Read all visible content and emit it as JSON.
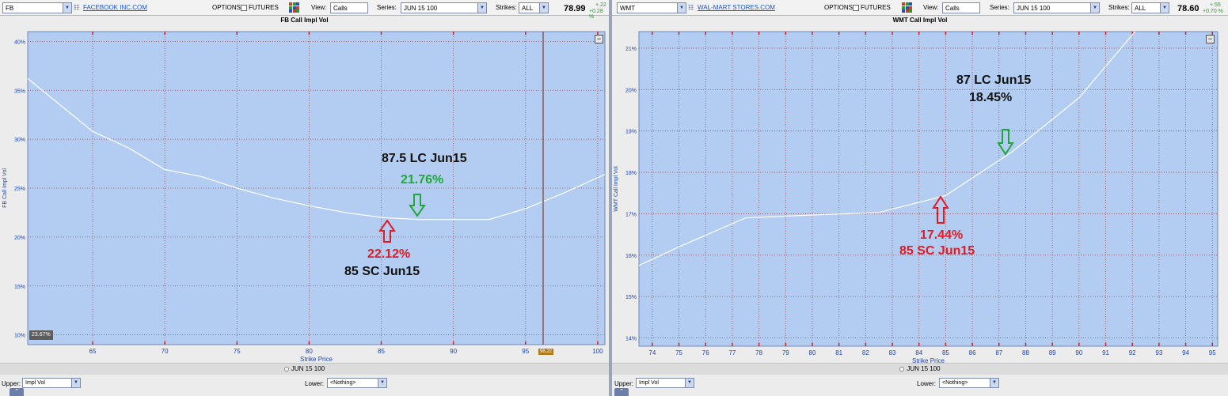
{
  "colors": {
    "plot_bg": "#b2cdf1",
    "grid": "#a84a4a",
    "curve": "#ffffff",
    "axis_text": "#1f47a5",
    "positive": "#2a9b2a",
    "annotation_green": "#1fa83a",
    "annotation_red": "#e01b24"
  },
  "left": {
    "symbol": "FB",
    "company": "FACEBOOK INC.COM",
    "options_label": "OPTIONS",
    "futures_label": "FUTURES",
    "view_label": "View:",
    "view_value": "Calls",
    "series_label": "Series:",
    "series_value": "JUN 15 100",
    "strikes_label": "Strikes:",
    "strikes_value": "ALL",
    "price": "78.99",
    "change_abs": "+.22",
    "change_pct": "+0.28 %",
    "series_bar": "JUN 15 100",
    "upper_label": "Upper:",
    "upper_value": "Impl Vol",
    "lower_label": "Lower:",
    "lower_value": "<Nothing>",
    "cursor_value": "23.67%",
    "price_marker": "96.22",
    "annotations": {
      "long_title": "87.5 LC Jun15",
      "long_value": "21.76%",
      "short_value": "22.12%",
      "short_title": "85 SC Jun15"
    }
  },
  "right": {
    "symbol": "WMT",
    "company": "WAL-MART STORES.COM",
    "options_label": "OPTIONS",
    "futures_label": "FUTURES",
    "view_label": "View:",
    "view_value": "Calls",
    "series_label": "Series:",
    "series_value": "JUN 15 100",
    "strikes_label": "Strikes:",
    "strikes_value": "ALL",
    "price": "78.60",
    "change_abs": "+.55",
    "change_pct": "+0.70 %",
    "series_bar": "JUN 15 100",
    "upper_label": "Upper:",
    "upper_value": "Impl Vol",
    "lower_label": "Lower:",
    "lower_value": "<Nothing>",
    "annotations": {
      "long_title": "87 LC Jun15",
      "long_value": "18.45%",
      "short_value": "17.44%",
      "short_title": "85 SC Jun15"
    }
  },
  "chart_data": [
    {
      "type": "line",
      "title": "FB Call Impl Vol",
      "xlabel": "Strike Price",
      "ylabel": "FB Call Impl Vol",
      "xlim": [
        60.5,
        100.5
      ],
      "ylim": [
        9,
        41
      ],
      "x_ticks": [
        "65",
        "70",
        "75",
        "80",
        "85",
        "90",
        "95",
        "100"
      ],
      "y_ticks": [
        "10%",
        "15%",
        "20%",
        "25%",
        "30%",
        "35%",
        "40%"
      ],
      "grid": true,
      "series": [
        {
          "x": [
            60.5,
            62.5,
            65,
            67.5,
            70,
            72.5,
            75,
            77.5,
            80,
            82.5,
            85,
            87.5,
            90,
            92.5,
            95,
            97.5,
            100.5
          ],
          "values": [
            36.2,
            33.8,
            30.8,
            29.1,
            26.9,
            26.2,
            25.0,
            24.0,
            23.2,
            22.5,
            22.0,
            21.8,
            21.8,
            21.8,
            22.9,
            24.4,
            26.4
          ]
        }
      ]
    },
    {
      "type": "line",
      "title": "WMT Call Impl Vol",
      "xlabel": "Strike Price",
      "ylabel": "WMT Call Impl Vol",
      "xlim": [
        73.5,
        95.2
      ],
      "ylim": [
        13.8,
        21.4
      ],
      "x_ticks": [
        "74",
        "75",
        "76",
        "77",
        "78",
        "79",
        "80",
        "81",
        "82",
        "83",
        "84",
        "85",
        "86",
        "87",
        "88",
        "89",
        "90",
        "91",
        "92",
        "93",
        "94",
        "95"
      ],
      "y_ticks": [
        "14%",
        "15%",
        "16%",
        "17%",
        "18%",
        "19%",
        "20%",
        "21%"
      ],
      "grid": true,
      "series": [
        {
          "x": [
            73.5,
            75,
            77.5,
            80,
            82.5,
            85,
            87.5,
            90,
            92.1
          ],
          "values": [
            15.75,
            16.2,
            16.9,
            16.97,
            17.03,
            17.44,
            18.5,
            19.8,
            21.4
          ]
        }
      ]
    }
  ]
}
